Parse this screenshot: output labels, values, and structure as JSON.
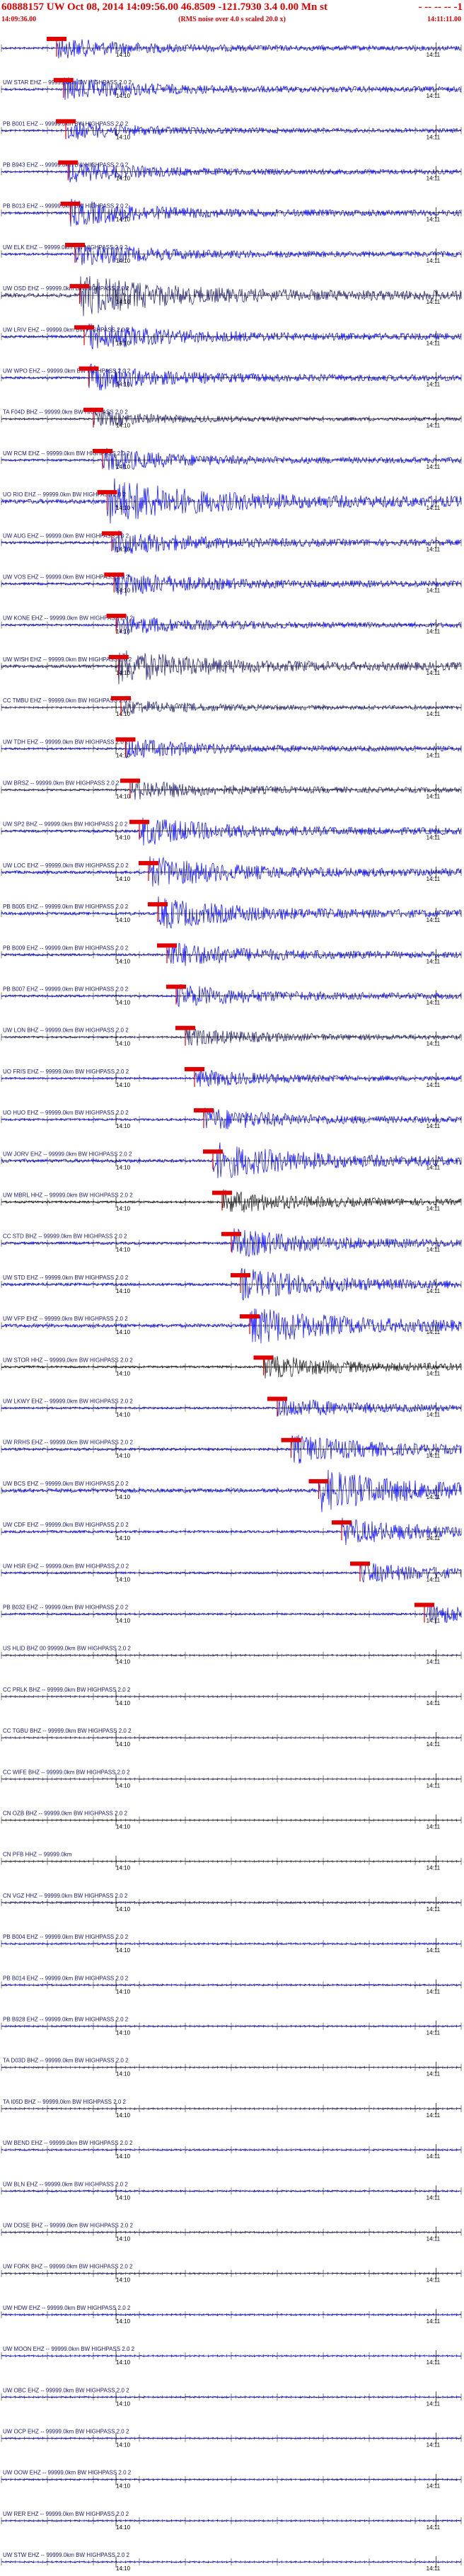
{
  "header": {
    "title": "60888157 UW Oct 08, 2014 14:09:56.00   46.8509 -121.7930  3.4 0.00 Mn st",
    "title_suffix": "- -- -- -- -1",
    "start_time": "14:09:36.00",
    "note": "(RMS noise over 4.0 s scaled 20.0 x)",
    "end_time": "14:11:11.00"
  },
  "chart_data": {
    "type": "line",
    "time_tick_label": "14:10",
    "time_tick_label_2": "14:11",
    "colors": {
      "trace": "#0000ff",
      "alt_trace_1": "#1a1a6e",
      "alt_trace_2": "#111111",
      "pick": "#e00000",
      "axis": "#000000"
    },
    "traces": [
      {
        "label": "",
        "amp": 8,
        "pick": 0.12,
        "color": "#0000ff"
      },
      {
        "label": "UW STAR EHZ -- 99999.0km BW  HIGHPASS  2.0  2",
        "amp": 9,
        "pick": 0.135,
        "color": "#0000ff"
      },
      {
        "label": "PB B001 EHZ -- 99999.0km BW  HIGHPASS  2.0  2",
        "amp": 7,
        "pick": 0.14,
        "color": "#0000ff"
      },
      {
        "label": "PB B943 EHZ -- 99999.0km BW  HIGHPASS  2.0  2",
        "amp": 8,
        "pick": 0.145,
        "color": "#0000ff"
      },
      {
        "label": "PB B013 EHZ -- 99999.0km BW  HIGHPASS  2.0  2",
        "amp": 10,
        "pick": 0.15,
        "color": "#0000ff"
      },
      {
        "label": "UW ELK EHZ -- 99999.0km BW  HIGHPASS  2.0  2",
        "amp": 9,
        "pick": 0.16,
        "color": "#0000ff"
      },
      {
        "label": "UW OSD EHZ -- 99999.0km BW  HIGHPASS  2.0  2",
        "amp": 16,
        "pick": 0.17,
        "color": "#1a1a6e"
      },
      {
        "label": "UW LRIV EHZ -- 99999.0km BW  HIGHPASS  2.0  2",
        "amp": 11,
        "pick": 0.18,
        "color": "#0000ff"
      },
      {
        "label": "UW WPO EHZ -- 99999.0km BW  HIGHPASS  2.0  2",
        "amp": 10,
        "pick": 0.19,
        "color": "#0000ff"
      },
      {
        "label": "TA F04D BHZ -- 99999.0km BW  HIGHPASS  2.0  2",
        "amp": 6,
        "pick": 0.2,
        "color": "#1a1a6e"
      },
      {
        "label": "UW RCM EHZ -- 99999.0km BW  HIGHPASS  2.0  2",
        "amp": 9,
        "pick": 0.22,
        "color": "#0000ff"
      },
      {
        "label": "UO RIO EHZ -- 99999.0km BW  HIGHPASS  2.0  2",
        "amp": 18,
        "pick": 0.23,
        "color": "#0000ff"
      },
      {
        "label": "UW AUG EHZ -- 99999.0km BW  HIGHPASS  2.0  2",
        "amp": 10,
        "pick": 0.24,
        "color": "#0000ff"
      },
      {
        "label": "UW VOS EHZ -- 99999.0km BW  HIGHPASS  2.0  2",
        "amp": 10,
        "pick": 0.245,
        "color": "#0000ff"
      },
      {
        "label": "UW KONE EHZ -- 99999.0km BW  HIGHPASS  2.0  2",
        "amp": 8,
        "pick": 0.25,
        "color": "#0000ff"
      },
      {
        "label": "UW WISH EHZ -- 99999.0km BW  HIGHPASS  2.0  2",
        "amp": 13,
        "pick": 0.255,
        "color": "#1a1a6e"
      },
      {
        "label": "CC TMBU EHZ -- 99999.0km BW  HIGHPASS  2.0  2",
        "amp": 6,
        "pick": 0.26,
        "color": "#1a1a6e"
      },
      {
        "label": "UW TDH EHZ -- 99999.0km BW  HIGHPASS  2.0  2",
        "amp": 8,
        "pick": 0.27,
        "color": "#0000ff"
      },
      {
        "label": "UW BRSZ -- 99999.0km BW  HIGHPASS  2.0  2",
        "amp": 8,
        "pick": 0.28,
        "color": "#1a1a6e"
      },
      {
        "label": "UW SP2 BHZ -- 99999.0km BW  HIGHPASS  2.0  2",
        "amp": 11,
        "pick": 0.3,
        "color": "#0000ff"
      },
      {
        "label": "UW LOC EHZ -- 99999.0km BW  HIGHPASS  2.0  2",
        "amp": 12,
        "pick": 0.32,
        "color": "#0000ff"
      },
      {
        "label": "PB B005 EHZ -- 99999.0km BW  HIGHPASS  2.0  2",
        "amp": 12,
        "pick": 0.34,
        "color": "#0000ff"
      },
      {
        "label": "PB B009 EHZ -- 99999.0km BW  HIGHPASS  2.0  2",
        "amp": 10,
        "pick": 0.36,
        "color": "#0000ff"
      },
      {
        "label": "PB B007 EHZ -- 99999.0km BW  HIGHPASS  2.0  2",
        "amp": 9,
        "pick": 0.38,
        "color": "#0000ff"
      },
      {
        "label": "UW LON BHZ -- 99999.0km BW  HIGHPASS  2.0  2",
        "amp": 7,
        "pick": 0.4,
        "color": "#1a1a6e"
      },
      {
        "label": "UO FRIS EHZ -- 99999.0km BW  HIGHPASS  2.0  2",
        "amp": 7,
        "pick": 0.42,
        "color": "#0000ff"
      },
      {
        "label": "UO HUO EHZ -- 99999.0km BW  HIGHPASS  2.0  2",
        "amp": 9,
        "pick": 0.44,
        "color": "#0000ff"
      },
      {
        "label": "UW JORV EHZ -- 99999.0km BW  HIGHPASS  2.0  2",
        "amp": 14,
        "pick": 0.46,
        "color": "#0000ff"
      },
      {
        "label": "UW MBRL HHZ -- 99999.0km BW  HIGHPASS  2.0  2",
        "amp": 9,
        "pick": 0.48,
        "color": "#111111"
      },
      {
        "label": "CC STD BHZ -- 99999.0km BW  HIGHPASS  2.0  2",
        "amp": 11,
        "pick": 0.5,
        "color": "#0000ff"
      },
      {
        "label": "UW STD EHZ -- 99999.0km BW  HIGHPASS  2.0  2",
        "amp": 12,
        "pick": 0.52,
        "color": "#0000ff"
      },
      {
        "label": "UW VFP EHZ -- 99999.0km BW  HIGHPASS  2.0  2",
        "amp": 15,
        "pick": 0.54,
        "color": "#0000ff"
      },
      {
        "label": "UW STOR HHZ -- 99999.0km BW  HIGHPASS  2.0  2",
        "amp": 9,
        "pick": 0.57,
        "color": "#111111"
      },
      {
        "label": "UW LKWY EHZ -- 99999.0km BW  HIGHPASS  2.0  2",
        "amp": 8,
        "pick": 0.6,
        "color": "#0000ff"
      },
      {
        "label": "UW RRHS EHZ -- 99999.0km BW  HIGHPASS  2.0  2",
        "amp": 11,
        "pick": 0.63,
        "color": "#0000ff"
      },
      {
        "label": "UW BCS EHZ -- 99999.0km BW  HIGHPASS  2.0  2",
        "amp": 16,
        "pick": 0.69,
        "color": "#0000ff"
      },
      {
        "label": "UW CDF EHZ -- 99999.0km BW  HIGHPASS  2.0  2",
        "amp": 10,
        "pick": 0.74,
        "color": "#0000ff"
      },
      {
        "label": "UW HSR EHZ -- 99999.0km BW  HIGHPASS  2.0  2",
        "amp": 8,
        "pick": 0.78,
        "color": "#0000ff"
      },
      {
        "label": "PB B032 EHZ -- 99999.0km BW  HIGHPASS  2.0  2",
        "amp": 8,
        "pick": 0.92,
        "color": "#0000ff"
      },
      {
        "label": "US HLID BHZ 00 99999.0km BW  HIGHPASS  2.0  2",
        "amp": 5,
        "pick": -1,
        "color": "#1a1a6e"
      },
      {
        "label": "CC PRLK BHZ -- 99999.0km BW  HIGHPASS  2.0  2",
        "amp": 4,
        "pick": -1,
        "color": "#1a1a6e"
      },
      {
        "label": "CC TGBU BHZ -- 99999.0km BW  HIGHPASS  2.0  2",
        "amp": 4,
        "pick": -1,
        "color": "#1a1a6e"
      },
      {
        "label": "CC WIFE BHZ -- 99999.0km BW  HIGHPASS  2.0  2",
        "amp": 3,
        "pick": -1,
        "color": "#1a1a6e"
      },
      {
        "label": "CN OZB BHZ -- 99999.0km BW  HIGHPASS  2.0  2",
        "amp": 3,
        "pick": -1,
        "color": "#111111"
      },
      {
        "label": "CN PFB HHZ -- 99999.0km",
        "amp": 3,
        "pick": -1,
        "color": "#111111"
      },
      {
        "label": "CN VGZ HHZ -- 99999.0km BW  HIGHPASS  2.0  2",
        "amp": 7,
        "pick": -1,
        "color": "#1a1a6e"
      },
      {
        "label": "PB B004 EHZ -- 99999.0km BW  HIGHPASS  2.0  2",
        "amp": 7,
        "pick": -1,
        "color": "#0000ff"
      },
      {
        "label": "PB B014 EHZ -- 99999.0km BW  HIGHPASS  2.0  2",
        "amp": 6,
        "pick": -1,
        "color": "#0000ff"
      },
      {
        "label": "PB B928 EHZ -- 99999.0km BW  HIGHPASS  2.0  2",
        "amp": 5,
        "pick": -1,
        "color": "#0000ff"
      },
      {
        "label": "TA D03D BHZ -- 99999.0km BW  HIGHPASS  2.0  2",
        "amp": 4,
        "pick": -1,
        "color": "#1a1a6e"
      },
      {
        "label": "TA I05D BHZ -- 99999.0km BW  HIGHPASS  2.0  2",
        "amp": 4,
        "pick": -1,
        "color": "#1a1a6e"
      },
      {
        "label": "UW BEND EHZ -- 99999.0km BW  HIGHPASS  2.0  2",
        "amp": 6,
        "pick": -1,
        "color": "#0000ff"
      },
      {
        "label": "UW BLN EHZ -- 99999.0km BW  HIGHPASS  2.0  2",
        "amp": 6,
        "pick": -1,
        "color": "#0000ff"
      },
      {
        "label": "UW DOSE BHZ -- 99999.0km BW  HIGHPASS  2.0  2",
        "amp": 5,
        "pick": -1,
        "color": "#1a1a6e"
      },
      {
        "label": "UW FORK BHZ -- 99999.0km BW  HIGHPASS  2.0  2",
        "amp": 5,
        "pick": -1,
        "color": "#1a1a6e"
      },
      {
        "label": "UW HDW EHZ -- 99999.0km BW  HIGHPASS  2.0  2",
        "amp": 6,
        "pick": -1,
        "color": "#0000ff"
      },
      {
        "label": "UW MOON EHZ -- 99999.0km BW  HIGHPASS  2.0  2",
        "amp": 5,
        "pick": -1,
        "color": "#0000ff"
      },
      {
        "label": "UW OBC EHZ -- 99999.0km BW  HIGHPASS  2.0  2",
        "amp": 5,
        "pick": -1,
        "color": "#0000ff"
      },
      {
        "label": "UW OCP EHZ -- 99999.0km BW  HIGHPASS  2.0  2",
        "amp": 5,
        "pick": -1,
        "color": "#0000ff"
      },
      {
        "label": "UW OOW EHZ -- 99999.0km BW  HIGHPASS  2.0  2",
        "amp": 5,
        "pick": -1,
        "color": "#0000ff"
      },
      {
        "label": "UW RER EHZ -- 99999.0km BW  HIGHPASS  2.0  2",
        "amp": 5,
        "pick": -1,
        "color": "#0000ff"
      },
      {
        "label": "UW STW EHZ -- 99999.0km BW  HIGHPASS  2.0  2",
        "amp": 5,
        "pick": -1,
        "color": "#0000ff"
      }
    ]
  }
}
